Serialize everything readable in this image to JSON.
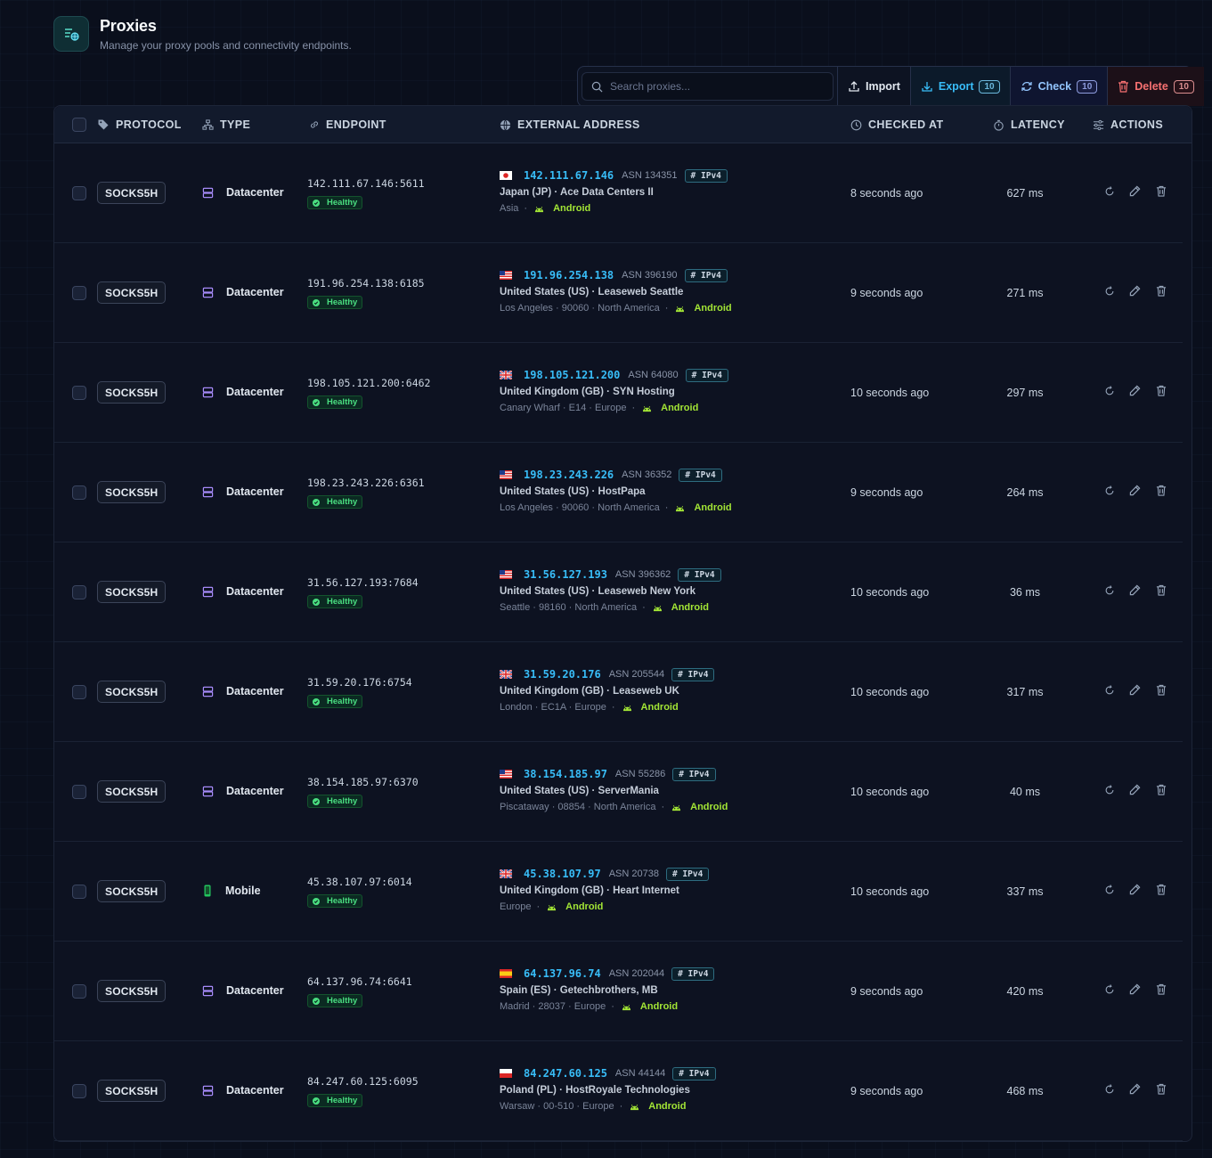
{
  "header": {
    "title": "Proxies",
    "subtitle": "Manage your proxy pools and connectivity endpoints."
  },
  "toolbar": {
    "search_placeholder": "Search proxies...",
    "import_label": "Import",
    "export_label": "Export",
    "export_count": "10",
    "check_label": "Check",
    "check_count": "10",
    "delete_label": "Delete",
    "delete_count": "10"
  },
  "columns": {
    "protocol": "PROTOCOL",
    "type": "TYPE",
    "endpoint": "ENDPOINT",
    "external": "EXTERNAL ADDRESS",
    "checked": "CHECKED AT",
    "latency": "LATENCY",
    "actions": "ACTIONS"
  },
  "colors": {
    "accent": "#38bdf8",
    "healthy": "#4ade80",
    "android": "#a3e635",
    "datacenter_icon": "#a78bfa",
    "mobile_icon": "#22c55e",
    "delete": "#f87171"
  },
  "rows": [
    {
      "protocol": "SOCKS5H",
      "type": "Datacenter",
      "type_icon": "server-icon",
      "endpoint": "142.111.67.146:5611",
      "status": "Healthy",
      "flag": "jp",
      "ip": "142.111.67.146",
      "asn": "ASN 134351",
      "ipver": "IPv4",
      "org": "Japan (JP) · Ace Data Centers II",
      "location": "Asia",
      "os": "Android",
      "checked": "8 seconds ago",
      "latency": "627 ms"
    },
    {
      "protocol": "SOCKS5H",
      "type": "Datacenter",
      "type_icon": "server-icon",
      "endpoint": "191.96.254.138:6185",
      "status": "Healthy",
      "flag": "us",
      "ip": "191.96.254.138",
      "asn": "ASN 396190",
      "ipver": "IPv4",
      "org": "United States (US) · Leaseweb Seattle",
      "location": "Los Angeles · 90060 · North America",
      "os": "Android",
      "checked": "9 seconds ago",
      "latency": "271 ms"
    },
    {
      "protocol": "SOCKS5H",
      "type": "Datacenter",
      "type_icon": "server-icon",
      "endpoint": "198.105.121.200:6462",
      "status": "Healthy",
      "flag": "gb",
      "ip": "198.105.121.200",
      "asn": "ASN 64080",
      "ipver": "IPv4",
      "org": "United Kingdom (GB) · SYN Hosting",
      "location": "Canary Wharf · E14 · Europe",
      "os": "Android",
      "checked": "10 seconds ago",
      "latency": "297 ms"
    },
    {
      "protocol": "SOCKS5H",
      "type": "Datacenter",
      "type_icon": "server-icon",
      "endpoint": "198.23.243.226:6361",
      "status": "Healthy",
      "flag": "us",
      "ip": "198.23.243.226",
      "asn": "ASN 36352",
      "ipver": "IPv4",
      "org": "United States (US) · HostPapa",
      "location": "Los Angeles · 90060 · North America",
      "os": "Android",
      "checked": "9 seconds ago",
      "latency": "264 ms"
    },
    {
      "protocol": "SOCKS5H",
      "type": "Datacenter",
      "type_icon": "server-icon",
      "endpoint": "31.56.127.193:7684",
      "status": "Healthy",
      "flag": "us",
      "ip": "31.56.127.193",
      "asn": "ASN 396362",
      "ipver": "IPv4",
      "org": "United States (US) · Leaseweb New York",
      "location": "Seattle · 98160 · North America",
      "os": "Android",
      "checked": "10 seconds ago",
      "latency": "36 ms"
    },
    {
      "protocol": "SOCKS5H",
      "type": "Datacenter",
      "type_icon": "server-icon",
      "endpoint": "31.59.20.176:6754",
      "status": "Healthy",
      "flag": "gb",
      "ip": "31.59.20.176",
      "asn": "ASN 205544",
      "ipver": "IPv4",
      "org": "United Kingdom (GB) · Leaseweb UK",
      "location": "London · EC1A · Europe",
      "os": "Android",
      "checked": "10 seconds ago",
      "latency": "317 ms"
    },
    {
      "protocol": "SOCKS5H",
      "type": "Datacenter",
      "type_icon": "server-icon",
      "endpoint": "38.154.185.97:6370",
      "status": "Healthy",
      "flag": "us",
      "ip": "38.154.185.97",
      "asn": "ASN 55286",
      "ipver": "IPv4",
      "org": "United States (US) · ServerMania",
      "location": "Piscataway · 08854 · North America",
      "os": "Android",
      "checked": "10 seconds ago",
      "latency": "40 ms"
    },
    {
      "protocol": "SOCKS5H",
      "type": "Mobile",
      "type_icon": "phone-icon",
      "endpoint": "45.38.107.97:6014",
      "status": "Healthy",
      "flag": "gb",
      "ip": "45.38.107.97",
      "asn": "ASN 20738",
      "ipver": "IPv4",
      "org": "United Kingdom (GB) · Heart Internet",
      "location": "Europe",
      "os": "Android",
      "checked": "10 seconds ago",
      "latency": "337 ms"
    },
    {
      "protocol": "SOCKS5H",
      "type": "Datacenter",
      "type_icon": "server-icon",
      "endpoint": "64.137.96.74:6641",
      "status": "Healthy",
      "flag": "es",
      "ip": "64.137.96.74",
      "asn": "ASN 202044",
      "ipver": "IPv4",
      "org": "Spain (ES) · Getechbrothers, MB",
      "location": "Madrid · 28037 · Europe",
      "os": "Android",
      "checked": "9 seconds ago",
      "latency": "420 ms"
    },
    {
      "protocol": "SOCKS5H",
      "type": "Datacenter",
      "type_icon": "server-icon",
      "endpoint": "84.247.60.125:6095",
      "status": "Healthy",
      "flag": "pl",
      "ip": "84.247.60.125",
      "asn": "ASN 44144",
      "ipver": "IPv4",
      "org": "Poland (PL) · HostRoyale Technologies",
      "location": "Warsaw · 00-510 · Europe",
      "os": "Android",
      "checked": "9 seconds ago",
      "latency": "468 ms"
    }
  ]
}
